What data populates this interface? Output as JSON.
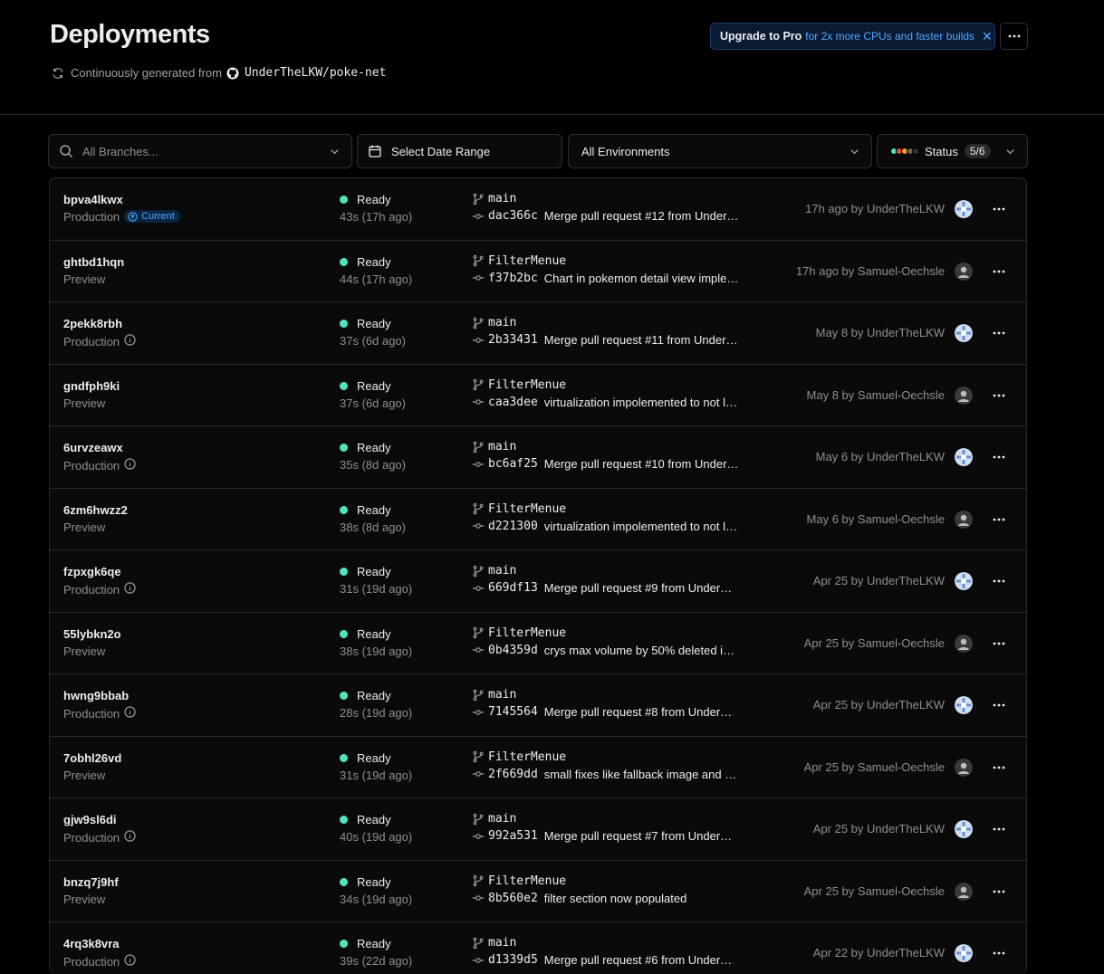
{
  "header": {
    "title": "Deployments",
    "source_prefix": "Continuously generated from",
    "repo": "UnderTheLKW/poke-net",
    "upgrade_strong": "Upgrade to Pro",
    "upgrade_rest": "for 2x more CPUs and faster builds"
  },
  "filters": {
    "branch_placeholder": "All Branches...",
    "date": "Select Date Range",
    "environment": "All Environments",
    "status_label": "Status",
    "status_count": "5/6"
  },
  "colors": {
    "ready": "#50e3c2",
    "accent": "#52a8ff"
  },
  "deployments": [
    {
      "id": "bpva4lkwx",
      "env": "Production",
      "current": "Current",
      "status": "Ready",
      "duration": "43s (17h ago)",
      "branch": "main",
      "hash": "dac366c",
      "message": "Merge pull request #12 from UnderT…",
      "meta": "17h ago by UnderTheLKW",
      "avatar": "underthelkw"
    },
    {
      "id": "ghtbd1hqn",
      "env": "Preview",
      "status": "Ready",
      "duration": "44s (17h ago)",
      "branch": "FilterMenue",
      "hash": "f37b2bc",
      "message": "Chart in pokemon detail view imple…",
      "meta": "17h ago by Samuel-Oechsle",
      "avatar": "samuel"
    },
    {
      "id": "2pekk8rbh",
      "env": "Production",
      "status": "Ready",
      "duration": "37s (6d ago)",
      "branch": "main",
      "hash": "2b33431",
      "message": "Merge pull request #11 from UnderTh…",
      "meta": "May 8 by UnderTheLKW",
      "avatar": "underthelkw"
    },
    {
      "id": "gndfph9ki",
      "env": "Preview",
      "status": "Ready",
      "duration": "37s (6d ago)",
      "branch": "FilterMenue",
      "hash": "caa3dee",
      "message": "virtualization impolemented to not l…",
      "meta": "May 8 by Samuel-Oechsle",
      "avatar": "samuel"
    },
    {
      "id": "6urvzeawx",
      "env": "Production",
      "status": "Ready",
      "duration": "35s (8d ago)",
      "branch": "main",
      "hash": "bc6af25",
      "message": "Merge pull request #10 from UnderT…",
      "meta": "May 6 by UnderTheLKW",
      "avatar": "underthelkw"
    },
    {
      "id": "6zm6hwzz2",
      "env": "Preview",
      "status": "Ready",
      "duration": "38s (8d ago)",
      "branch": "FilterMenue",
      "hash": "d221300",
      "message": "virtualization impolemented to not l…",
      "meta": "May 6 by Samuel-Oechsle",
      "avatar": "samuel"
    },
    {
      "id": "fzpxgk6qe",
      "env": "Production",
      "status": "Ready",
      "duration": "31s (19d ago)",
      "branch": "main",
      "hash": "669df13",
      "message": "Merge pull request #9 from UnderTh…",
      "meta": "Apr 25 by UnderTheLKW",
      "avatar": "underthelkw"
    },
    {
      "id": "55lybkn2o",
      "env": "Preview",
      "status": "Ready",
      "duration": "38s (19d ago)",
      "branch": "FilterMenue",
      "hash": "0b4359d",
      "message": "crys max volume by 50% deleted im…",
      "meta": "Apr 25 by Samuel-Oechsle",
      "avatar": "samuel"
    },
    {
      "id": "hwng9bbab",
      "env": "Production",
      "status": "Ready",
      "duration": "28s (19d ago)",
      "branch": "main",
      "hash": "7145564",
      "message": "Merge pull request #8 from UnderTh…",
      "meta": "Apr 25 by UnderTheLKW",
      "avatar": "underthelkw"
    },
    {
      "id": "7obhl26vd",
      "env": "Preview",
      "status": "Ready",
      "duration": "31s (19d ago)",
      "branch": "FilterMenue",
      "hash": "2f669dd",
      "message": "small fixes like fallback image and …",
      "meta": "Apr 25 by Samuel-Oechsle",
      "avatar": "samuel"
    },
    {
      "id": "gjw9sl6di",
      "env": "Production",
      "status": "Ready",
      "duration": "40s (19d ago)",
      "branch": "main",
      "hash": "992a531",
      "message": "Merge pull request #7 from UnderTh…",
      "meta": "Apr 25 by UnderTheLKW",
      "avatar": "underthelkw"
    },
    {
      "id": "bnzq7j9hf",
      "env": "Preview",
      "status": "Ready",
      "duration": "34s (19d ago)",
      "branch": "FilterMenue",
      "hash": "8b560e2",
      "message": "filter section now populated",
      "meta": "Apr 25 by Samuel-Oechsle",
      "avatar": "samuel"
    },
    {
      "id": "4rq3k8vra",
      "env": "Production",
      "status": "Ready",
      "duration": "39s (22d ago)",
      "branch": "main",
      "hash": "d1339d5",
      "message": "Merge pull request #6 from UnderTh…",
      "meta": "Apr 22 by UnderTheLKW",
      "avatar": "underthelkw"
    }
  ]
}
